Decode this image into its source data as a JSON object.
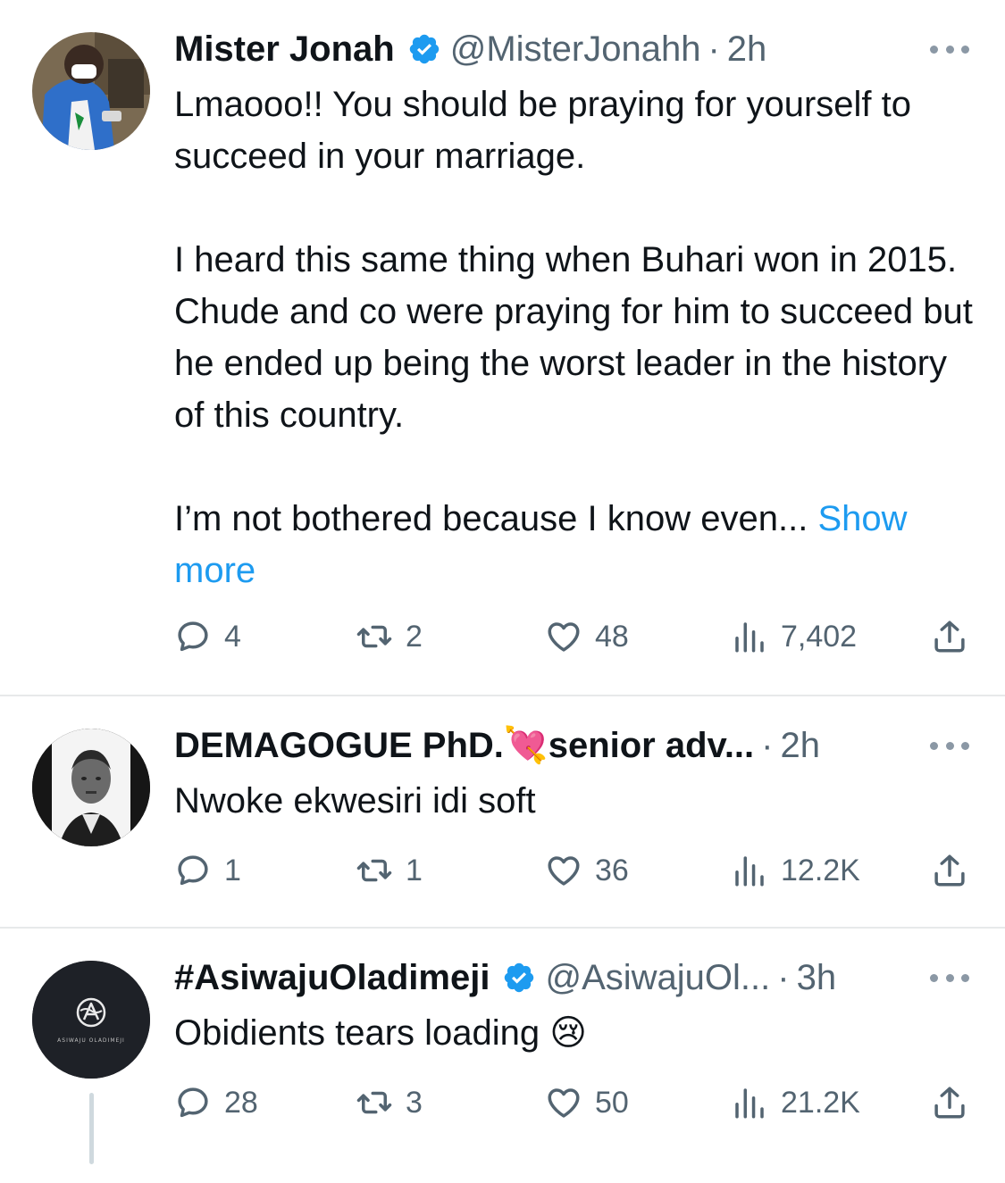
{
  "tweets": [
    {
      "name": "Mister Jonah",
      "verified": true,
      "handle": "@MisterJonahh",
      "dot": "·",
      "time": "2h",
      "paragraphs": [
        "Lmaooo!! You should be praying for yourself to succeed in your marriage.",
        "I heard this same thing when Buhari won in 2015. Chude and co were praying for him to succeed but he ended up being the worst leader in the history of this country.",
        "I’m not bothered because I know even..."
      ],
      "show_more": "Show more",
      "stats": {
        "replies": "4",
        "retweets": "2",
        "likes": "48",
        "views": "7,402"
      }
    },
    {
      "name": "DEMAGOGUE PhD.💘senior adv...",
      "verified": false,
      "handle": "",
      "dot": "·",
      "time": "2h",
      "paragraphs": [
        "Nwoke ekwesiri idi soft"
      ],
      "stats": {
        "replies": "1",
        "retweets": "1",
        "likes": "36",
        "views": "12.2K"
      }
    },
    {
      "name": "#AsiwajuOladimeji",
      "verified": true,
      "handle": "@AsiwajuOl...",
      "dot": "·",
      "time": "3h",
      "avatar_caption": "ASIWAJU OLADIMEJI",
      "paragraphs": [
        "Obidients tears loading 😢"
      ],
      "stats": {
        "replies": "28",
        "retweets": "3",
        "likes": "50",
        "views": "21.2K"
      }
    }
  ],
  "colors": {
    "text": "#0f1419",
    "secondary": "#536471",
    "link": "#1d9bf0",
    "divider": "#e7e9ea"
  }
}
